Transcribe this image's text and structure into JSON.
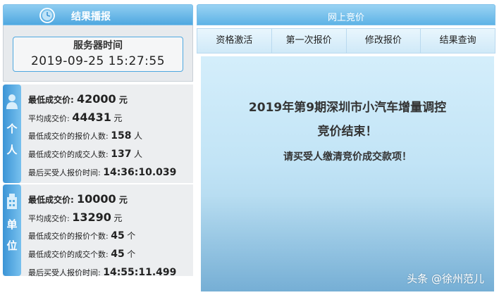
{
  "left": {
    "header_title": "结果播报",
    "server_label": "服务器时间",
    "server_time": "2019-09-25 15:27:55",
    "personal": {
      "tab_label": "个\n人",
      "min_price_label": "最低成交价:",
      "min_price_value": "42000",
      "min_price_unit": "元",
      "avg_price_label": "平均成交价:",
      "avg_price_value": "44431",
      "avg_price_unit": "元",
      "bid_count_label": "最低成交价的报价人数:",
      "bid_count_value": "158",
      "bid_count_unit": "人",
      "deal_count_label": "最低成交价的成交人数:",
      "deal_count_value": "137",
      "deal_count_unit": "人",
      "last_time_label": "最后买受人报价时间:",
      "last_time_value": "14:36:10.039"
    },
    "unit": {
      "tab_label": "单\n位",
      "min_price_label": "最低成交价:",
      "min_price_value": "10000",
      "min_price_unit": "元",
      "avg_price_label": "平均成交价:",
      "avg_price_value": "13290",
      "avg_price_unit": "元",
      "bid_count_label": "最低成交价的报价个数:",
      "bid_count_value": "45",
      "bid_count_unit": "个",
      "deal_count_label": "最低成交价的成交个数:",
      "deal_count_value": "45",
      "deal_count_unit": "个",
      "last_time_label": "最后买受人报价时间:",
      "last_time_value": "14:55:11.499"
    }
  },
  "right": {
    "header_title": "网上竞价",
    "tabs": [
      "资格激活",
      "第一次报价",
      "修改报价",
      "结果查询"
    ],
    "message_line1": "2019年第9期深圳市小汽车增量调控",
    "message_line2": "竞价结束！",
    "message_line3": "请买受人缴清竞价成交款项！"
  },
  "watermark": "头条 @徐州范儿",
  "icons": {
    "header_icon": "clock-icon",
    "personal_icon": "person-icon",
    "unit_icon": "building-icon"
  },
  "colors": {
    "header_blue": "#4fa8e0",
    "tab_blue": "#3b94d6",
    "panel_gray": "#eceef0"
  }
}
